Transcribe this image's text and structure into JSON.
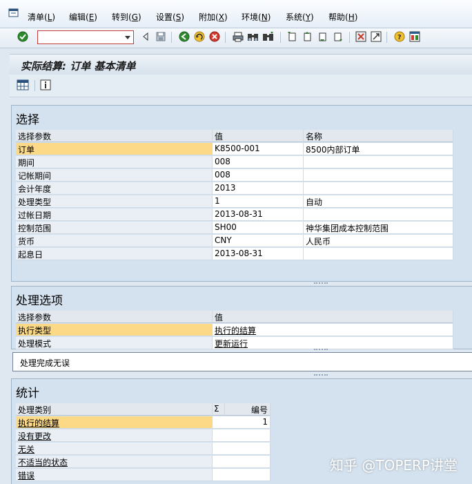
{
  "menu": [
    {
      "label": "清单",
      "key": "L"
    },
    {
      "label": "编辑",
      "key": "E"
    },
    {
      "label": "转到",
      "key": "G"
    },
    {
      "label": "设置",
      "key": "S"
    },
    {
      "label": "附加",
      "key": "X"
    },
    {
      "label": "环境",
      "key": "N"
    },
    {
      "label": "系统",
      "key": "Y"
    },
    {
      "label": "帮助",
      "key": "H"
    }
  ],
  "command_field": {
    "value": ""
  },
  "title": "实际结算: 订单 基本清单",
  "selection": {
    "title": "选择",
    "headers": [
      "选择参数",
      "值",
      "名称"
    ],
    "rows": [
      [
        "订单",
        "K8500-001",
        "8500内部订单"
      ],
      [
        "期间",
        "008",
        ""
      ],
      [
        "记帐期间",
        "008",
        ""
      ],
      [
        "会计年度",
        "2013",
        ""
      ],
      [
        "处理类型",
        "1",
        "自动"
      ],
      [
        "过帐日期",
        "2013-08-31",
        ""
      ],
      [
        "控制范围",
        "SH00",
        "神华集团成本控制范围"
      ],
      [
        "货币",
        "CNY",
        "人民币"
      ],
      [
        "起息日",
        "2013-08-31",
        ""
      ]
    ]
  },
  "options": {
    "title": "处理选项",
    "headers": [
      "选择参数",
      "值"
    ],
    "rows": [
      [
        "执行类型",
        "执行的结算"
      ],
      [
        "处理模式",
        "更新运行"
      ]
    ]
  },
  "status_message": "处理完成无误",
  "stats": {
    "title": "统计",
    "headers": [
      "处理类别",
      "Σ",
      "编号"
    ],
    "rows": [
      [
        "执行的结算",
        "1"
      ],
      [
        "没有更改",
        ""
      ],
      [
        "无关",
        ""
      ],
      [
        "不适当的状态",
        ""
      ],
      [
        "错误",
        ""
      ]
    ]
  },
  "watermark": "知乎 @TOPERP讲堂",
  "colors": {
    "selected_row": "#fcd987",
    "background": "#dfe8f1"
  }
}
